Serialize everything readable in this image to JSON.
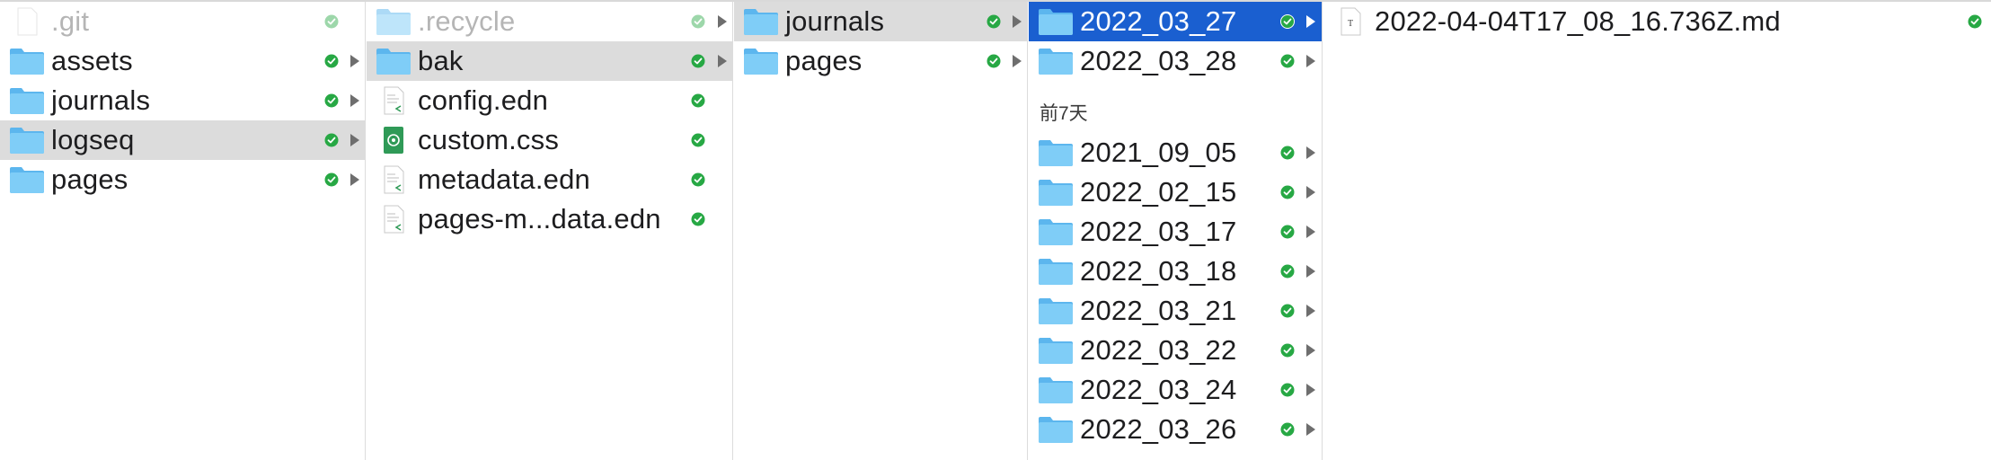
{
  "columns": [
    {
      "items": [
        {
          "label": ".git",
          "icon": "file-icon",
          "dim": true,
          "arrow": false,
          "selected": ""
        },
        {
          "label": "assets",
          "icon": "folder-icon",
          "dim": false,
          "arrow": true,
          "selected": ""
        },
        {
          "label": "journals",
          "icon": "folder-icon",
          "dim": false,
          "arrow": true,
          "selected": ""
        },
        {
          "label": "logseq",
          "icon": "folder-icon",
          "dim": false,
          "arrow": true,
          "selected": "gray"
        },
        {
          "label": "pages",
          "icon": "folder-icon",
          "dim": false,
          "arrow": true,
          "selected": ""
        }
      ]
    },
    {
      "items": [
        {
          "label": ".recycle",
          "icon": "folder-icon",
          "dim": true,
          "arrow": true,
          "selected": ""
        },
        {
          "label": "bak",
          "icon": "folder-icon",
          "dim": false,
          "arrow": true,
          "selected": "gray"
        },
        {
          "label": "config.edn",
          "icon": "code-file-icon",
          "dim": false,
          "arrow": false,
          "selected": ""
        },
        {
          "label": "custom.css",
          "icon": "css-file-icon",
          "dim": false,
          "arrow": false,
          "selected": ""
        },
        {
          "label": "metadata.edn",
          "icon": "code-file-icon",
          "dim": false,
          "arrow": false,
          "selected": ""
        },
        {
          "label": "pages-m...data.edn",
          "icon": "code-file-icon",
          "dim": false,
          "arrow": false,
          "selected": ""
        }
      ]
    },
    {
      "items": [
        {
          "label": "journals",
          "icon": "folder-icon",
          "dim": false,
          "arrow": true,
          "selected": "gray"
        },
        {
          "label": "pages",
          "icon": "folder-icon",
          "dim": false,
          "arrow": true,
          "selected": ""
        }
      ]
    },
    {
      "top_items": [
        {
          "label": "2022_03_27",
          "icon": "folder-icon",
          "dim": false,
          "arrow": true,
          "selected": "blue"
        },
        {
          "label": "2022_03_28",
          "icon": "folder-icon",
          "dim": false,
          "arrow": true,
          "selected": ""
        }
      ],
      "section_header": "前7天",
      "items": [
        {
          "label": "2021_09_05",
          "icon": "folder-icon",
          "dim": false,
          "arrow": true,
          "selected": ""
        },
        {
          "label": "2022_02_15",
          "icon": "folder-icon",
          "dim": false,
          "arrow": true,
          "selected": ""
        },
        {
          "label": "2022_03_17",
          "icon": "folder-icon",
          "dim": false,
          "arrow": true,
          "selected": ""
        },
        {
          "label": "2022_03_18",
          "icon": "folder-icon",
          "dim": false,
          "arrow": true,
          "selected": ""
        },
        {
          "label": "2022_03_21",
          "icon": "folder-icon",
          "dim": false,
          "arrow": true,
          "selected": ""
        },
        {
          "label": "2022_03_22",
          "icon": "folder-icon",
          "dim": false,
          "arrow": true,
          "selected": ""
        },
        {
          "label": "2022_03_24",
          "icon": "folder-icon",
          "dim": false,
          "arrow": true,
          "selected": ""
        },
        {
          "label": "2022_03_26",
          "icon": "folder-icon",
          "dim": false,
          "arrow": true,
          "selected": ""
        }
      ]
    },
    {
      "items": [
        {
          "label": "2022-04-04T17_08_16.736Z.md",
          "icon": "text-file-icon",
          "dim": false,
          "arrow": false,
          "selected": ""
        }
      ]
    }
  ],
  "colors": {
    "selection_blue": "#1a5fd0",
    "selection_gray": "#dcdcdc",
    "folder_blue": "#6cc3f5",
    "sync_green": "#27a844"
  }
}
